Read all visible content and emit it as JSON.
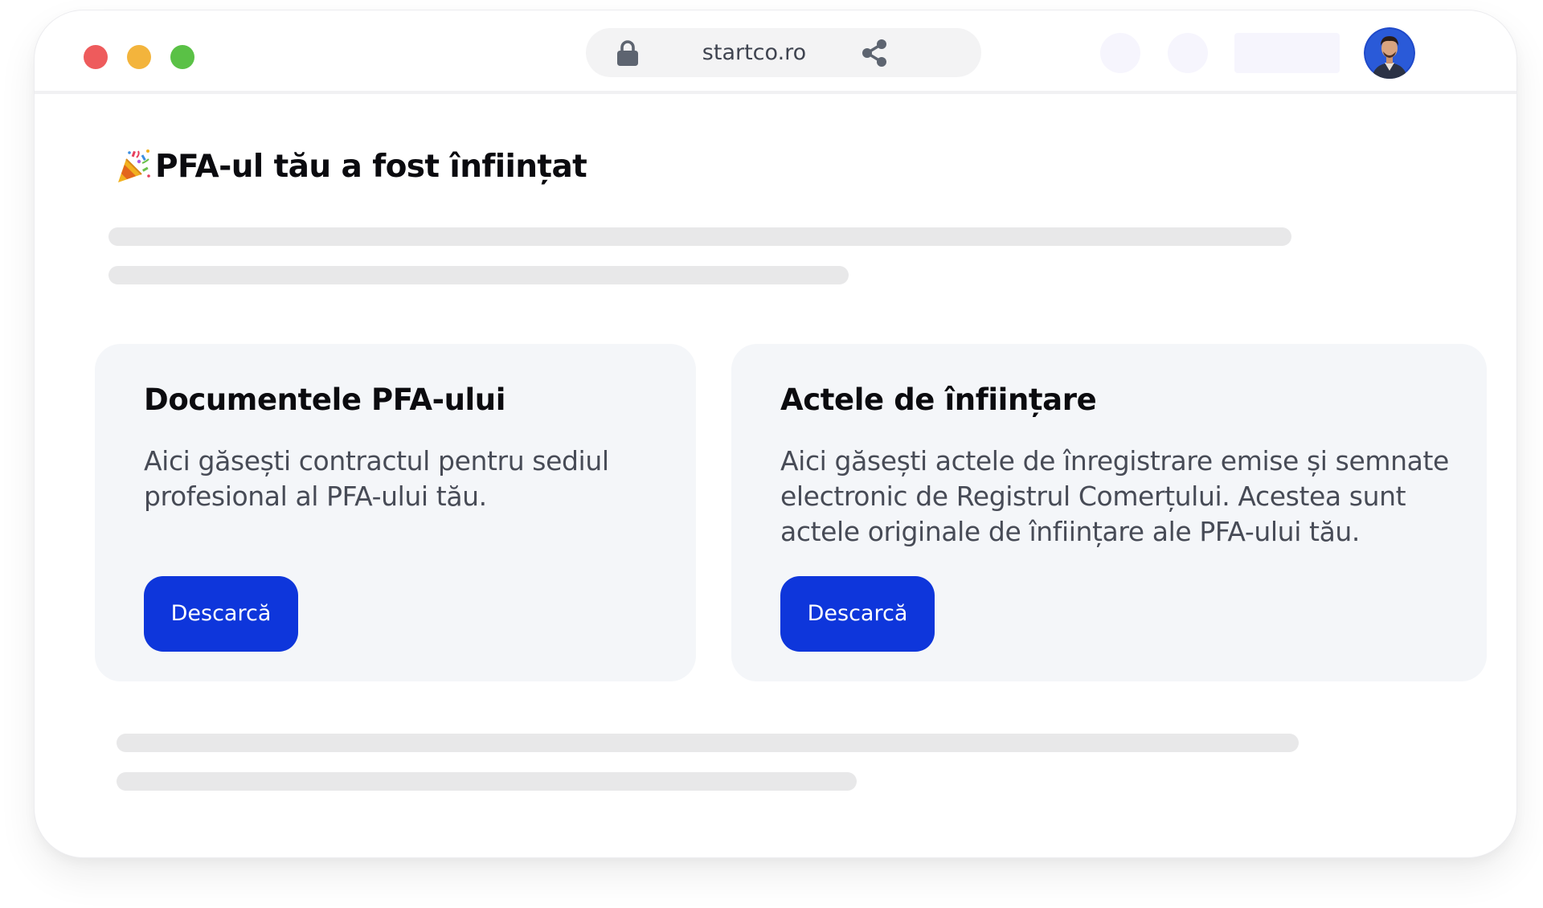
{
  "browser": {
    "window_controls": {
      "close_color": "#ee5b5c",
      "minimize_color": "#f3b43c",
      "maximize_color": "#5ac146"
    },
    "address_bar": {
      "url": "startco.ro",
      "lock_icon": "lock-icon",
      "share_icon": "share-icon"
    },
    "avatar_icon": "avatar"
  },
  "page": {
    "title_icon": "party-popper-icon",
    "title": "PFA-ul tău a fost înființat"
  },
  "cards": [
    {
      "title": "Documentele PFA-ului",
      "description": "Aici găsești contractul pentru sediul profesional al PFA-ului tău.",
      "button_label": "Descarcă"
    },
    {
      "title": "Actele de înființare",
      "description": "Aici găsești actele de înregistrare emise și semnate electronic de Registrul Comerțului. Acestea sunt actele originale de înființare ale PFA-ului tău.",
      "button_label": "Descarcă"
    }
  ],
  "colors": {
    "accent": "#0e36db",
    "card_background": "#f4f6f9",
    "skeleton": "#e8e8e9"
  }
}
